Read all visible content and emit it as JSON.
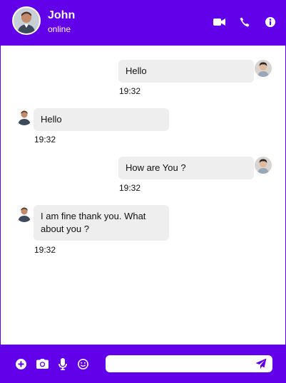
{
  "header": {
    "name": "John",
    "status": "online",
    "accent": "#6200ea"
  },
  "header_actions": [
    {
      "icon": "video-camera-icon"
    },
    {
      "icon": "phone-icon"
    },
    {
      "icon": "info-icon"
    }
  ],
  "messages": [
    {
      "from": "me",
      "text": "Hello",
      "time": "19:32"
    },
    {
      "from": "john",
      "text": "Hello",
      "time": "19:32"
    },
    {
      "from": "me",
      "text": "How are You ?",
      "time": "19:32"
    },
    {
      "from": "john",
      "text": "I am fine thank you. What about you ?",
      "time": "19:32"
    }
  ],
  "composer": {
    "value": "",
    "placeholder": "",
    "tools": [
      "plus-circle-icon",
      "camera-icon",
      "microphone-icon",
      "smiley-icon"
    ],
    "send_icon": "send-icon"
  },
  "colors": {
    "bubble": "#eeeeee",
    "header_bg": "#6200ea"
  }
}
